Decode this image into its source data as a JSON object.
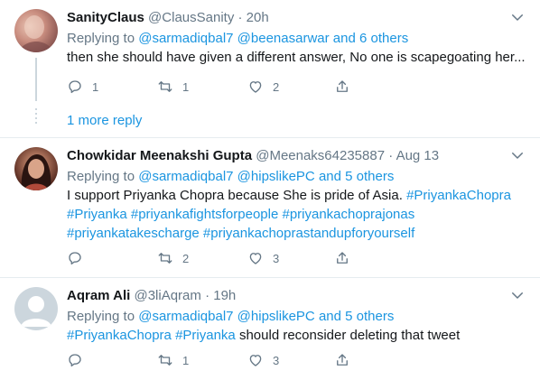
{
  "tweets": [
    {
      "name": "SanityClaus",
      "handle": "@ClausSanity",
      "sep": "·",
      "time": "20h",
      "replying_prefix": "Replying to",
      "replying_users": "@sarmadiqbal7 @beenasarwar",
      "and_others": "and 6 others",
      "text": "then she should have given a different answer, No one is scapegoating her...",
      "actions": {
        "reply_count": "1",
        "retweet_count": "1",
        "like_count": "2"
      }
    },
    {
      "name": "Chowkidar Meenakshi Gupta",
      "handle": "@Meenaks64235887",
      "sep": "·",
      "time": "Aug 13",
      "replying_prefix": "Replying to",
      "replying_users": "@sarmadiqbal7 @hipslikePC",
      "and_others": "and 5 others",
      "text_line1": "I support Priyanka Chopra because She is pride of Asia.",
      "hashtags_line1": "#PriyankaChopra",
      "hashtags_line2": "#Priyanka #priyankafightsforpeople #priyankachoprajonas",
      "hashtags_line3": "#priyankatakescharge #priyankachoprastandupforyourself",
      "actions": {
        "retweet_count": "2",
        "like_count": "3"
      }
    },
    {
      "name": "Aqram Ali",
      "handle": "@3liAqram",
      "sep": "·",
      "time": "19h",
      "replying_prefix": "Replying to",
      "replying_users": "@sarmadiqbal7 @hipslikePC",
      "and_others": "and 5 others",
      "hashtags": "#PriyankaChopra #Priyanka",
      "text": "should reconsider deleting that tweet",
      "actions": {
        "retweet_count": "1",
        "like_count": "3"
      }
    }
  ],
  "more_replies": "1 more reply",
  "colors": {
    "accent": "#1b95e0",
    "muted": "#657786",
    "divider": "#e6ecf0"
  },
  "icons": [
    "reply-icon",
    "retweet-icon",
    "like-icon",
    "share-icon",
    "chevron-down-icon"
  ]
}
